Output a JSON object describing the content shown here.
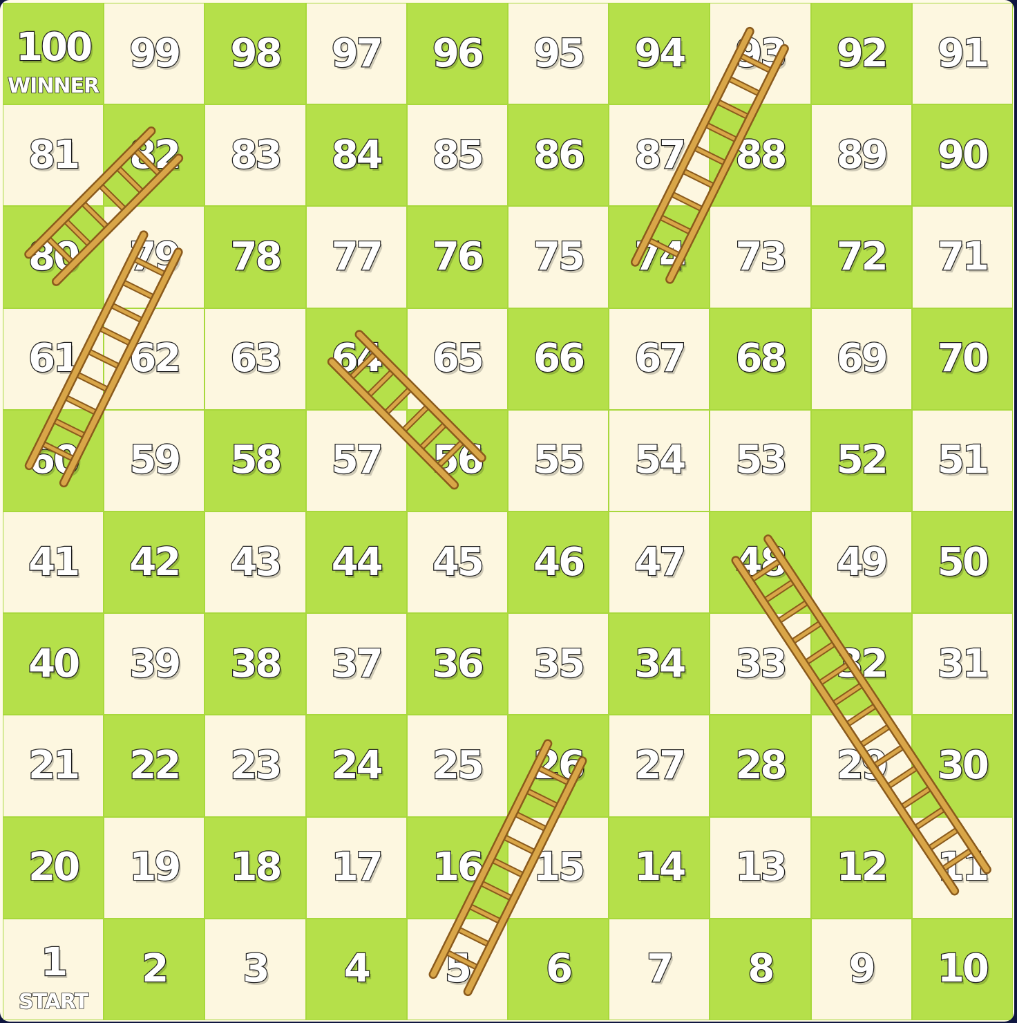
{
  "board": {
    "start_label": "START",
    "winner_label": "WINNER",
    "colors": {
      "green": "#b5e04a",
      "cream": "#fdf7e0",
      "ladder": "#d9a648",
      "ladder_outline": "#8a5a1c",
      "frame": "#0f1640"
    },
    "rows": [
      [
        100,
        99,
        98,
        97,
        96,
        95,
        94,
        93,
        92,
        91
      ],
      [
        81,
        82,
        83,
        84,
        85,
        86,
        87,
        88,
        89,
        90
      ],
      [
        80,
        79,
        78,
        77,
        76,
        75,
        74,
        73,
        72,
        71
      ],
      [
        61,
        62,
        63,
        64,
        65,
        66,
        67,
        68,
        69,
        70
      ],
      [
        60,
        59,
        58,
        57,
        56,
        55,
        54,
        53,
        52,
        51
      ],
      [
        41,
        42,
        43,
        44,
        45,
        46,
        47,
        48,
        49,
        50
      ],
      [
        40,
        39,
        38,
        37,
        36,
        35,
        34,
        33,
        32,
        31
      ],
      [
        21,
        22,
        23,
        24,
        25,
        26,
        27,
        28,
        29,
        30
      ],
      [
        20,
        19,
        18,
        17,
        16,
        15,
        14,
        13,
        12,
        11
      ],
      [
        1,
        2,
        3,
        4,
        5,
        6,
        7,
        8,
        9,
        10
      ]
    ],
    "green_cells": [
      100,
      98,
      96,
      94,
      92,
      82,
      84,
      86,
      88,
      90,
      80,
      78,
      76,
      74,
      72,
      64,
      66,
      68,
      70,
      60,
      58,
      56,
      52,
      42,
      44,
      46,
      48,
      50,
      40,
      38,
      36,
      34,
      32,
      22,
      24,
      26,
      28,
      30,
      20,
      18,
      16,
      14,
      12,
      2,
      4,
      6,
      8,
      10
    ]
  },
  "ladders": [
    {
      "from": 74,
      "to": 93
    },
    {
      "from": 80,
      "to": 82
    },
    {
      "from": 60,
      "to": 79
    },
    {
      "from": 56,
      "to": 64
    },
    {
      "from": 11,
      "to": 48
    },
    {
      "from": 5,
      "to": 26
    }
  ]
}
